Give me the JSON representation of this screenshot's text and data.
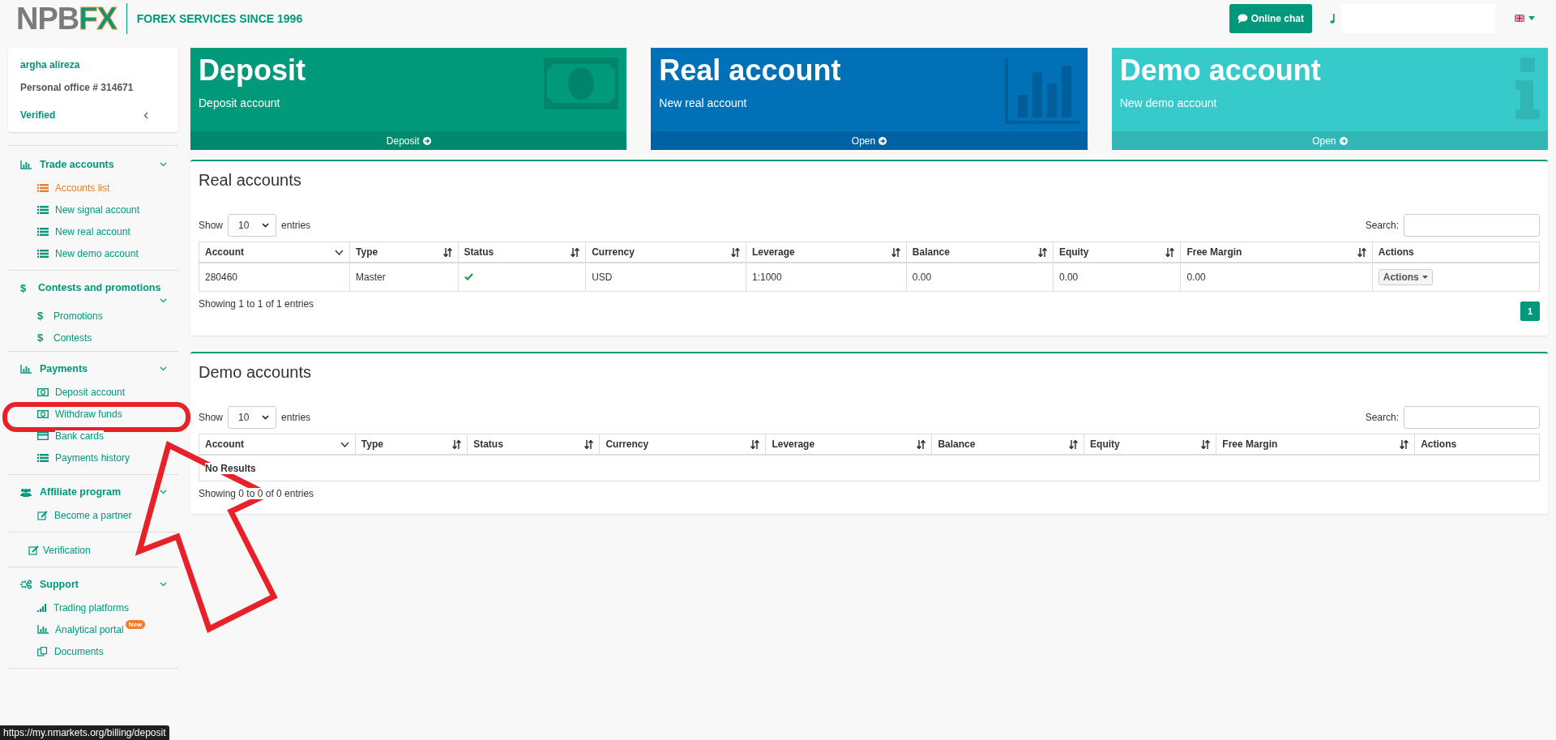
{
  "header": {
    "logo": {
      "first": "NPB",
      "second": "FX"
    },
    "tagline": "FOREX SERVICES SINCE 1996",
    "chat_button": "Online chat"
  },
  "profile": {
    "name": "argha alireza",
    "office": "Personal office # 314671",
    "status": "Verified"
  },
  "sidebar": [
    {
      "kind": "section",
      "title": "Trade accounts",
      "expanded": true,
      "items": [
        {
          "kind": "list",
          "label": "Accounts list",
          "selected": true
        },
        {
          "kind": "list",
          "label": "New signal account",
          "selected": false
        },
        {
          "kind": "list",
          "label": "New real account",
          "selected": false
        },
        {
          "kind": "list",
          "label": "New demo account",
          "selected": false
        }
      ]
    },
    {
      "kind": "section",
      "glyph": "$",
      "title": "Contests and promotions",
      "expanded": true,
      "items": [
        {
          "kind": "dollar",
          "glyph": "$",
          "label": "Promotions",
          "selected": false
        },
        {
          "kind": "dollar",
          "glyph": "$",
          "label": "Contests",
          "selected": false
        }
      ]
    },
    {
      "kind": "section",
      "title": "Payments",
      "expanded": true,
      "items": [
        {
          "kind": "money",
          "label": "Deposit account",
          "selected": false
        },
        {
          "kind": "money",
          "label": "Withdraw funds",
          "selected": false
        },
        {
          "kind": "card",
          "label": "Bank cards",
          "selected": false
        },
        {
          "kind": "list",
          "label": "Payments history",
          "selected": false
        }
      ]
    },
    {
      "kind": "section",
      "title": "Affiliate program",
      "expanded": true,
      "items": [
        {
          "kind": "edit",
          "label": "Become a partner",
          "selected": false
        }
      ]
    },
    {
      "kind": "link",
      "title": "Verification"
    },
    {
      "kind": "section",
      "title": "Support",
      "expanded": true,
      "items": [
        {
          "kind": "signal",
          "label": "Trading platforms",
          "selected": false
        },
        {
          "kind": "chart",
          "label": "Analytical portal",
          "badge": "New",
          "selected": false
        },
        {
          "kind": "docs",
          "label": "Documents",
          "selected": false
        }
      ]
    }
  ],
  "cards": [
    {
      "kind": "deposit",
      "title": "Deposit",
      "subtitle": "Deposit account",
      "link": "Deposit"
    },
    {
      "kind": "real",
      "title": "Real account",
      "subtitle": "New real account",
      "link": "Open"
    },
    {
      "kind": "demo",
      "title": "Demo account",
      "subtitle": "New demo account",
      "link": "Open"
    }
  ],
  "panels": [
    {
      "title": "Real accounts",
      "show": "Show",
      "page_size": "10",
      "entries": "entries",
      "search_label": "Search:",
      "columns": [
        {
          "label": "Account",
          "kind": "sorted"
        },
        {
          "label": "Type",
          "kind": "sortable"
        },
        {
          "label": "Status",
          "kind": "sortable"
        },
        {
          "label": "Currency",
          "kind": "sortable"
        },
        {
          "label": "Leverage",
          "kind": "sortable"
        },
        {
          "label": "Balance",
          "kind": "sortable"
        },
        {
          "label": "Equity",
          "kind": "sortable"
        },
        {
          "label": "Free Margin",
          "kind": "sortable"
        },
        {
          "label": "Actions",
          "kind": "plain"
        }
      ],
      "rows": [
        {
          "cells": [
            {
              "kind": "text",
              "text": "280460"
            },
            {
              "kind": "text",
              "text": "Master"
            },
            {
              "kind": "check",
              "on": true
            },
            {
              "kind": "text",
              "text": "USD"
            },
            {
              "kind": "text",
              "text": "1:1000"
            },
            {
              "kind": "text",
              "text": "0.00"
            },
            {
              "kind": "text",
              "text": "0.00"
            },
            {
              "kind": "text",
              "text": "0.00"
            },
            {
              "kind": "dropdown",
              "text": "Actions"
            }
          ]
        }
      ],
      "info": "Showing 1 to 1 of 1 entries",
      "pages": [
        {
          "label": "1",
          "selected": true
        }
      ]
    },
    {
      "title": "Demo accounts",
      "show": "Show",
      "page_size": "10",
      "entries": "entries",
      "search_label": "Search:",
      "columns": [
        {
          "label": "Account",
          "kind": "sorted"
        },
        {
          "label": "Type",
          "kind": "sortable"
        },
        {
          "label": "Status",
          "kind": "sortable"
        },
        {
          "label": "Currency",
          "kind": "sortable"
        },
        {
          "label": "Leverage",
          "kind": "sortable"
        },
        {
          "label": "Balance",
          "kind": "sortable"
        },
        {
          "label": "Equity",
          "kind": "sortable"
        },
        {
          "label": "Free Margin",
          "kind": "sortable"
        },
        {
          "label": "Actions",
          "kind": "plain"
        }
      ],
      "empty": "No Results",
      "info": "Showing 0 to 0 of 0 entries"
    }
  ],
  "status_url": "https://my.nmarkets.org/billing/deposit"
}
